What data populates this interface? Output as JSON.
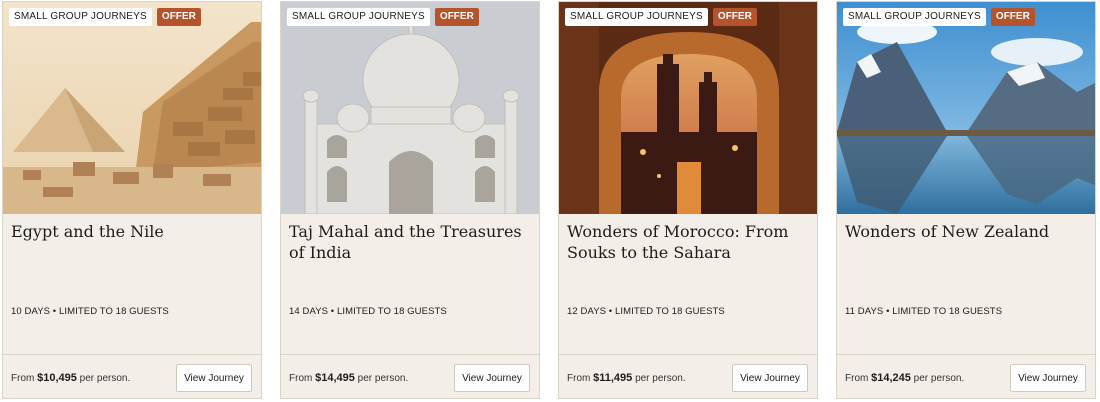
{
  "cards": [
    {
      "badge_type": "SMALL GROUP JOURNEYS",
      "badge_offer": "OFFER",
      "title": "Egypt and the Nile",
      "meta": "10 DAYS • LIMITED TO 18 GUESTS",
      "price_prefix": "From",
      "price": "$10,495",
      "price_suffix": "per person.",
      "button": "View Journey",
      "image": "pyramids-photo"
    },
    {
      "badge_type": "SMALL GROUP JOURNEYS",
      "badge_offer": "OFFER",
      "title": "Taj Mahal and the Treasures of India",
      "meta": "14 DAYS • LIMITED TO 18 GUESTS",
      "price_prefix": "From",
      "price": "$14,495",
      "price_suffix": "per person.",
      "button": "View Journey",
      "image": "taj-mahal-photo"
    },
    {
      "badge_type": "SMALL GROUP JOURNEYS",
      "badge_offer": "OFFER",
      "title": "Wonders of Morocco: From Souks to the Sahara",
      "meta": "12 DAYS • LIMITED TO 18 GUESTS",
      "price_prefix": "From",
      "price": "$11,495",
      "price_suffix": "per person.",
      "button": "View Journey",
      "image": "morocco-arch-photo"
    },
    {
      "badge_type": "SMALL GROUP JOURNEYS",
      "badge_offer": "OFFER",
      "title": "Wonders of New Zealand",
      "meta": "11 DAYS • LIMITED TO 18 GUESTS",
      "price_prefix": "From",
      "price": "$14,245",
      "price_suffix": "per person.",
      "button": "View Journey",
      "image": "new-zealand-fjord-photo"
    }
  ],
  "colors": {
    "card_bg": "#f3efe8",
    "offer_badge": "#b4532c",
    "text": "#1c1c1c"
  }
}
